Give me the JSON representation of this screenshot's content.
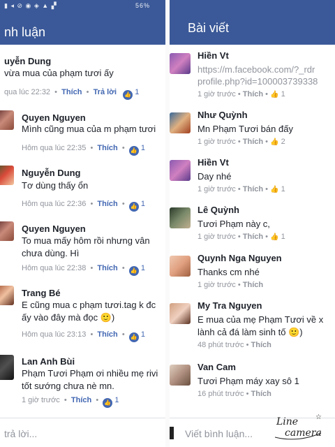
{
  "left": {
    "status_text": "56%",
    "header_title": "nh luận",
    "comments": [
      {
        "author": "uyễn Dung",
        "lines": [
          "vừa mua của phạm tươi ấy"
        ],
        "time": "qua lúc 22:32",
        "like": "Thích",
        "reply": "Trả lời",
        "likes": "1"
      },
      {
        "author": "Quyen Nguyen",
        "lines": [
          "Mình cũng mua của m phạm tươi"
        ],
        "time": "Hôm qua lúc 22:35",
        "like": "Thích",
        "likes": "1"
      },
      {
        "author": "Nguyễn Dung",
        "lines": [
          "Tơ dùng thấy ổn"
        ],
        "time": "Hôm qua lúc 22:36",
        "like": "Thích",
        "likes": "1"
      },
      {
        "author": "Quyen Nguyen",
        "lines": [
          "To mua mấy hôm rồi nhưng vân",
          "chưa dùng. Hì"
        ],
        "time": "Hôm qua lúc 22:38",
        "like": "Thích",
        "likes": "1"
      },
      {
        "author": "Trang Bé",
        "lines": [
          "E cũng mua c phạm tươi.tag k đc",
          "ấy vào đây mà đọc 🙂)"
        ],
        "time": "Hôm qua lúc 23:13",
        "like": "Thích",
        "likes": "1"
      },
      {
        "author": "Lan Anh Bùi",
        "lines": [
          "Phạm Tươi Phạm ơi nhiều mẹ rivi",
          "tốt sướng chưa nè mn."
        ],
        "time": "1 giờ trước",
        "like": "Thích",
        "likes": "1"
      }
    ],
    "composer_placeholder": "trả lời..."
  },
  "right": {
    "header_title": "Bài viết",
    "comments": [
      {
        "author": "Hiền Vt",
        "lines": [
          "https://m.facebook.com/?_rdr",
          "profile.php?id=100003739338"
        ],
        "time": "1 giờ trước",
        "like": "Thích",
        "likes": "1"
      },
      {
        "author": "Như Quỳnh",
        "lines": [
          "Mn Phạm Tươi bán đấy"
        ],
        "time": "1 giờ trước",
        "like": "Thích",
        "likes": "2"
      },
      {
        "author": "Hiền Vt",
        "lines": [
          "Day nhé"
        ],
        "time": "1 giờ trước",
        "like": "Thích",
        "likes": "1"
      },
      {
        "author": "Lê Quỳnh",
        "lines": [
          "Tươi Phạm này c,"
        ],
        "time": "1 giờ trước",
        "like": "Thích",
        "likes": "1"
      },
      {
        "author": "Quynh Nga Nguyen",
        "lines": [
          "Thanks cm nhé"
        ],
        "time": "1 giờ trước",
        "like": "Thích",
        "likes": ""
      },
      {
        "author": "My Tra Nguyen",
        "lines": [
          "E mua của mẹ Phạm Tươi về x",
          "lành cả đá làm sinh tố 🙂)"
        ],
        "time": "48 phút trước",
        "like": "Thích",
        "likes": ""
      },
      {
        "author": "Van Cam",
        "lines": [
          "Tươi Phạm máy xay sô 1"
        ],
        "time": "16 phút trước",
        "like": "Thích",
        "likes": ""
      }
    ],
    "composer_placeholder": "Viết bình luận..."
  },
  "watermark_text": "Line camera",
  "colors": {
    "header": "#3b5998",
    "link": "#4267b2",
    "meta": "#90949c"
  }
}
